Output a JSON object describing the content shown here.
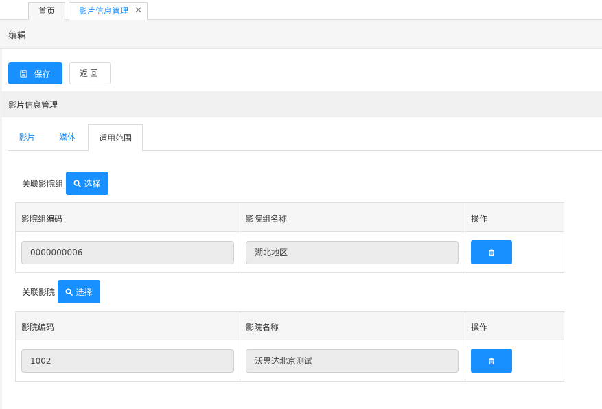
{
  "top_tabs": [
    {
      "label": "首页"
    },
    {
      "label": "影片信息管理",
      "close": "✕"
    }
  ],
  "edit_header": {
    "title": "编辑"
  },
  "toolbar": {
    "save_label": "保存",
    "back_label": "返回"
  },
  "section": {
    "title": "影片信息管理"
  },
  "tabs": [
    {
      "label": "影片"
    },
    {
      "label": "媒体"
    },
    {
      "label": "适用范围"
    }
  ],
  "cinema_group": {
    "label": "关联影院组",
    "choose_label": "选择",
    "columns": [
      "影院组编码",
      "影院组名称",
      "操作"
    ],
    "rows": [
      {
        "code": "0000000006",
        "name": "湖北地区"
      }
    ]
  },
  "cinema": {
    "label": "关联影院",
    "choose_label": "选择",
    "columns": [
      "影院编码",
      "影院名称",
      "操作"
    ],
    "rows": [
      {
        "code": "1002",
        "name": "沃思达北京测试"
      }
    ]
  },
  "icons": {
    "save": "save-icon",
    "search": "search-icon",
    "delete": "trash-icon",
    "close": "close-icon"
  },
  "colors": {
    "accent": "#1890ff"
  }
}
